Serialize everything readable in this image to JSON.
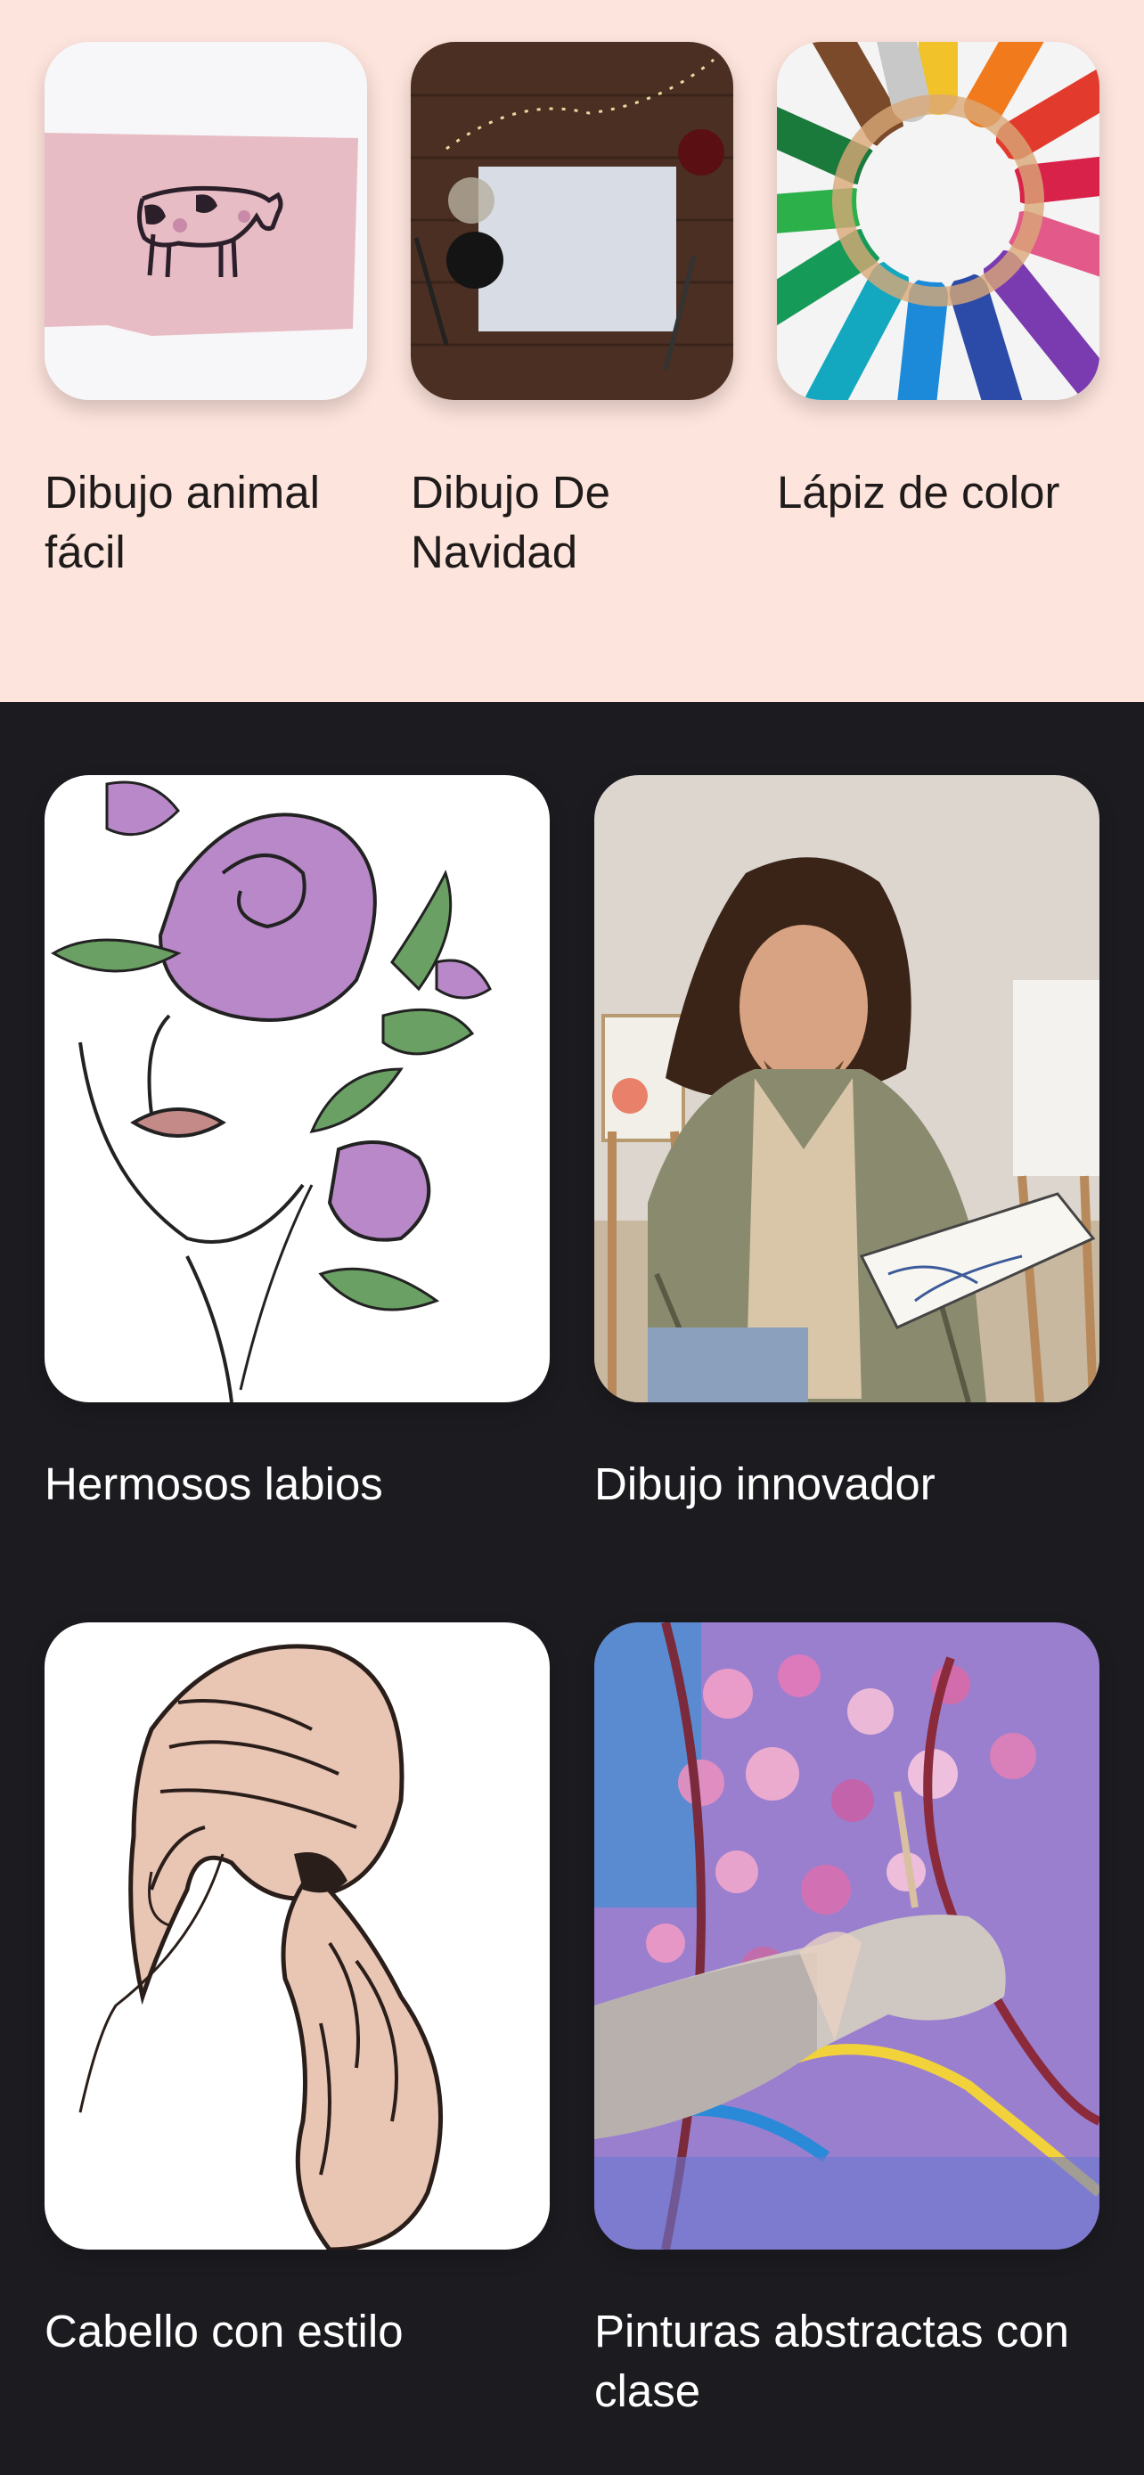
{
  "top_row": [
    {
      "label": "Dibujo animal fácil",
      "image": "cow-sketch-on-pink-paper"
    },
    {
      "label": "Dibujo De Navidad",
      "image": "paper-on-wooden-table-with-christmas-lights"
    },
    {
      "label": "Lápiz de color",
      "image": "colored-pencils-circle"
    }
  ],
  "grid": [
    {
      "label": "Hermosos labios",
      "image": "line-art-face-with-flowers"
    },
    {
      "label": "Dibujo innovador",
      "image": "artist-holding-sketchbook"
    },
    {
      "label": "Cabello con estilo",
      "image": "hair-ponytail-drawing"
    },
    {
      "label": "Pinturas abstractas con clase",
      "image": "hand-painting-abstract-canvas"
    }
  ],
  "colors": {
    "top_background": "#fde4dc",
    "bottom_background": "#1c1b20"
  }
}
